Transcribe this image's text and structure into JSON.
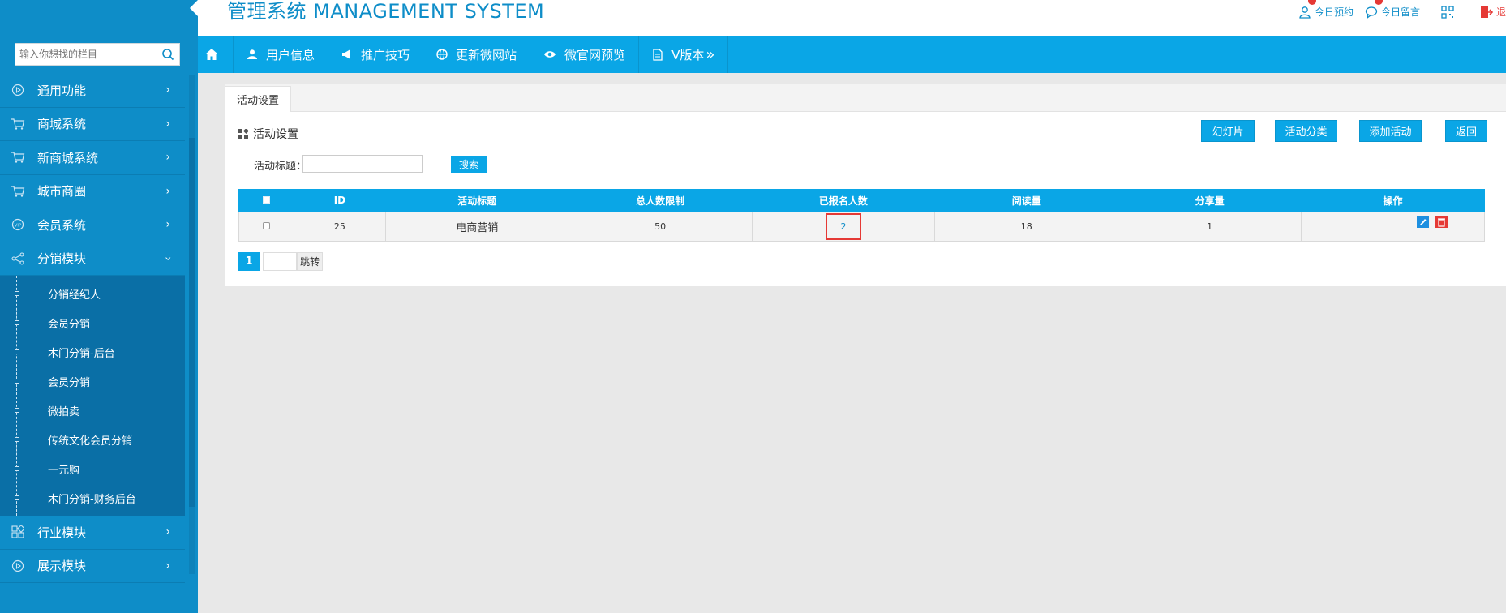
{
  "header": {
    "brand": "管理系统 MANAGEMENT SYSTEM",
    "links": [
      {
        "label": "今日预约",
        "icon": "user-icon"
      },
      {
        "label": "今日留言",
        "icon": "chat-icon"
      },
      {
        "label": "",
        "icon": "qr-code-icon"
      },
      {
        "label": "退",
        "icon": "logout-icon"
      }
    ]
  },
  "sidebar": {
    "search_placeholder": "输入你想找的栏目",
    "items": [
      {
        "label": "通用功能",
        "icon": "play-icon"
      },
      {
        "label": "商城系统",
        "icon": "cart-icon"
      },
      {
        "label": "新商城系统",
        "icon": "cart-icon"
      },
      {
        "label": "城市商圈",
        "icon": "cart-icon"
      },
      {
        "label": "会员系统",
        "icon": "vip-icon"
      },
      {
        "label": "分销模块",
        "icon": "share-icon"
      }
    ],
    "subitems": [
      "分销经纪人",
      "会员分销",
      "木门分销-后台",
      "会员分销",
      "微拍卖",
      "传统文化会员分销",
      "一元购",
      "木门分销-财务后台"
    ],
    "items_after": [
      {
        "label": "行业模块",
        "icon": "grid-icon"
      },
      {
        "label": "展示模块",
        "icon": "play-icon"
      }
    ]
  },
  "topnav": [
    "用户信息",
    "推广技巧",
    "更新微网站",
    "微官网预览",
    "V版本"
  ],
  "content": {
    "tab": "活动设置",
    "section_title": "活动设置",
    "buttons": [
      "幻灯片",
      "活动分类",
      "添加活动",
      "返回"
    ],
    "filter_label": "活动标题：",
    "filter_value": "",
    "search_button": "搜索",
    "table": {
      "headers": [
        "",
        "ID",
        "活动标题",
        "总人数限制",
        "已报名人数",
        "阅读量",
        "分享量",
        "操作"
      ],
      "rows": [
        {
          "id": "25",
          "title": "电商营销",
          "limit": "50",
          "signed": "2",
          "reads": "18",
          "shares": "1"
        }
      ]
    },
    "pager": {
      "page": "1",
      "go_label": "跳转"
    }
  },
  "colors": {
    "accent": "#0aa6e6",
    "sidebar": "#0e8dc8",
    "highlight": "#e53935"
  }
}
